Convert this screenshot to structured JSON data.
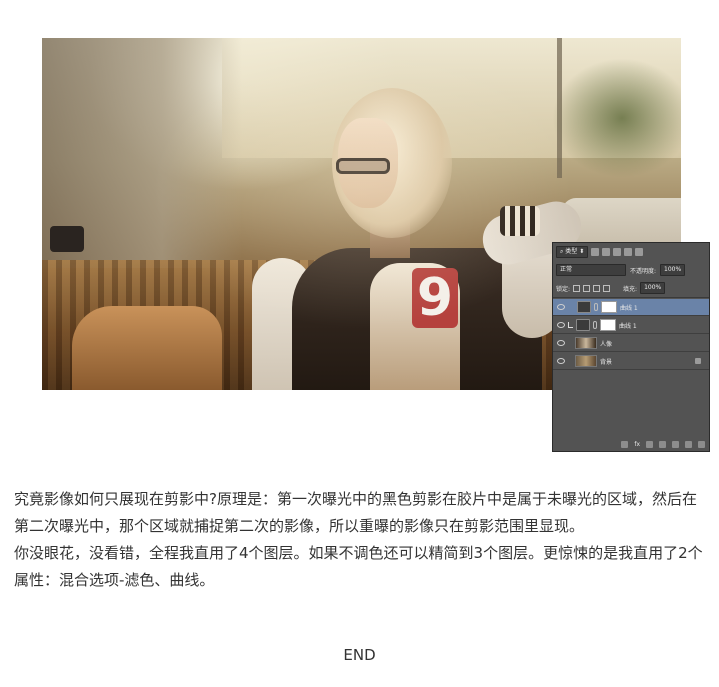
{
  "layers_panel": {
    "filter_type": "类型",
    "blend_mode": "正常",
    "opacity_label": "不透明度:",
    "opacity_value": "100%",
    "lock_label": "锁定:",
    "fill_label": "填充:",
    "fill_value": "100%",
    "layers": [
      {
        "name": "曲线 1",
        "kind": "curves",
        "selected": true
      },
      {
        "name": "曲线 1",
        "kind": "curves-clipped",
        "selected": false
      },
      {
        "name": "人像",
        "kind": "image",
        "selected": false
      },
      {
        "name": "背景",
        "kind": "background",
        "selected": false,
        "locked": true
      }
    ],
    "bottom_fx": "fx"
  },
  "photo": {
    "jersey_number": "9"
  },
  "article": {
    "paragraph1": "究竟影像如何只展现在剪影中?原理是：第一次曝光中的黑色剪影在胶片中是属于未曝光的区域，然后在第二次曝光中，那个区域就捕捉第二次的影像，所以重曝的影像只在剪影范围里显现。",
    "paragraph2": "你没眼花，没看错，全程我直用了4个图层。如果不调色还可以精简到3个图层。更惊悚的是我直用了2个属性：混合选项-滤色、曲线。",
    "end": "END"
  }
}
